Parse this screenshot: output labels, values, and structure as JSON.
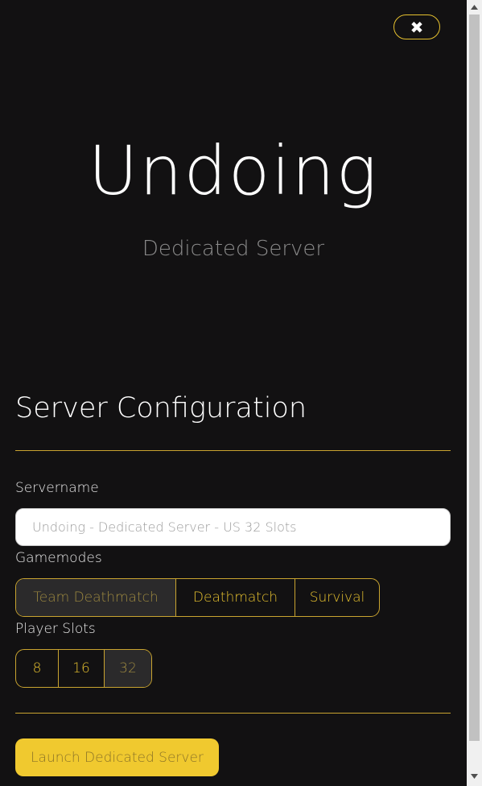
{
  "header": {
    "close_icon": "✖",
    "title": "Undoing",
    "subtitle": "Dedicated Server"
  },
  "config": {
    "section_title": "Server Configuration",
    "servername_label": "Servername",
    "servername_placeholder": "Undoing - Dedicated Server - US 32 Slots",
    "gamemodes_label": "Gamemodes",
    "gamemodes": [
      {
        "label": "Team Deathmatch",
        "selected": true
      },
      {
        "label": "Deathmatch",
        "selected": false
      },
      {
        "label": "Survival",
        "selected": false
      }
    ],
    "slots_label": "Player Slots",
    "slots": [
      {
        "label": "8",
        "selected": false
      },
      {
        "label": "16",
        "selected": false
      },
      {
        "label": "32",
        "selected": true
      }
    ],
    "launch_label": "Launch Dedicated Server"
  },
  "colors": {
    "accent": "#e6c12f",
    "background": "#121112",
    "button": "#f0c92f"
  }
}
